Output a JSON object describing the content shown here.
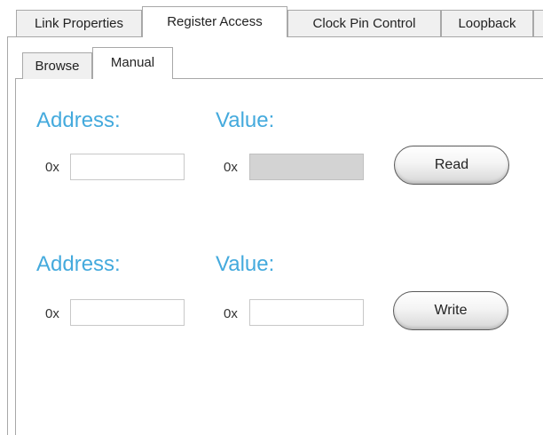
{
  "tabs": [
    {
      "label": "Link Properties"
    },
    {
      "label": "Register Access"
    },
    {
      "label": "Clock Pin Control"
    },
    {
      "label": "Loopback"
    }
  ],
  "subtabs": [
    {
      "label": "Browse"
    },
    {
      "label": "Manual"
    }
  ],
  "read_section": {
    "address_label": "Address:",
    "value_label": "Value:",
    "address_prefix": "0x",
    "value_prefix": "0x",
    "address_value": "",
    "value_value": "",
    "button_label": "Read"
  },
  "write_section": {
    "address_label": "Address:",
    "value_label": "Value:",
    "address_prefix": "0x",
    "value_prefix": "0x",
    "address_value": "",
    "value_value": "",
    "button_label": "Write"
  },
  "colors": {
    "section_label": "#44aadd",
    "readonly_field": "#d3d3d3"
  }
}
